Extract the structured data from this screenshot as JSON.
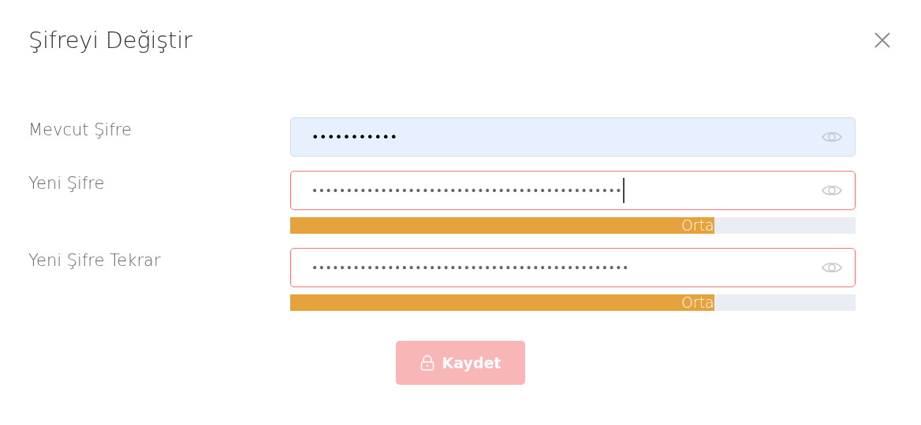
{
  "dialog": {
    "title": "Şifreyi Değiştir"
  },
  "fields": [
    {
      "label": "Mevcut Şifre",
      "value": "•••••••••••",
      "kind": "autofill",
      "invalid": false,
      "focused": false
    },
    {
      "label": "Yeni Şifre",
      "value": "•••••••••••••••••••••••••••••••••••••••••••••",
      "kind": "plain",
      "invalid": true,
      "focused": true,
      "strength": {
        "level": 0.75,
        "label": "Orta"
      }
    },
    {
      "label": "Yeni Şifre Tekrar",
      "value": "••••••••••••••••••••••••••••••••••••••••••••••",
      "kind": "plain",
      "invalid": true,
      "focused": false,
      "strength": {
        "level": 0.75,
        "label": "Orta"
      }
    }
  ],
  "save_button": {
    "label": "Kaydet",
    "disabled": true
  }
}
